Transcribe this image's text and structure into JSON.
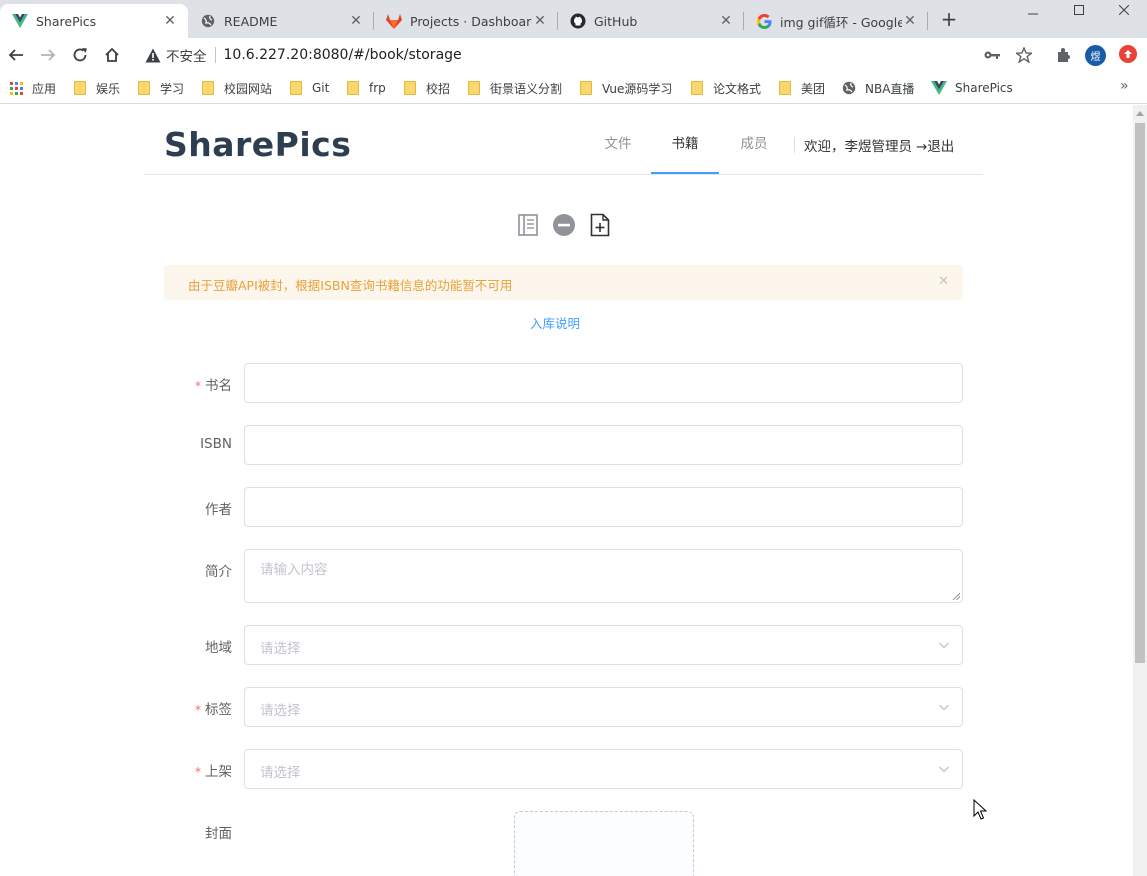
{
  "browser": {
    "tabs": [
      {
        "title": "SharePics",
        "favicon": "vue-icon",
        "active": true
      },
      {
        "title": "README",
        "favicon": "globe-icon",
        "active": false
      },
      {
        "title": "Projects · Dashboard",
        "favicon": "gitlab-icon",
        "active": false
      },
      {
        "title": "GitHub",
        "favicon": "github-icon",
        "active": false
      },
      {
        "title": "img gif循环 - Google",
        "favicon": "google-icon",
        "active": false
      }
    ],
    "security_label": "不安全",
    "url": "10.6.227.20:8080/#/book/storage",
    "profile_initial": "煜",
    "bookmarks": [
      {
        "label": "应用",
        "icon": "apps-grid-icon"
      },
      {
        "label": "娱乐",
        "icon": "folder-icon"
      },
      {
        "label": "学习",
        "icon": "folder-icon"
      },
      {
        "label": "校园网站",
        "icon": "folder-icon"
      },
      {
        "label": "Git",
        "icon": "folder-icon"
      },
      {
        "label": "frp",
        "icon": "folder-icon"
      },
      {
        "label": "校招",
        "icon": "folder-icon"
      },
      {
        "label": "街景语义分割",
        "icon": "folder-icon"
      },
      {
        "label": "Vue源码学习",
        "icon": "folder-icon"
      },
      {
        "label": "论文格式",
        "icon": "folder-icon"
      },
      {
        "label": "美团",
        "icon": "folder-icon"
      },
      {
        "label": "NBA直播",
        "icon": "globe-icon"
      },
      {
        "label": "SharePics",
        "icon": "vue-icon"
      }
    ]
  },
  "header": {
    "logo": "SharePics",
    "nav": [
      {
        "label": "文件",
        "active": false
      },
      {
        "label": "书籍",
        "active": true
      },
      {
        "label": "成员",
        "active": false
      }
    ],
    "welcome": "欢迎，李煜管理员",
    "logout": "退出"
  },
  "alert": {
    "message": "由于豆瓣API被封，根据ISBN查询书籍信息的功能暂不可用"
  },
  "help_link": "入库说明",
  "form": {
    "fields": [
      {
        "label": "书名",
        "required": true,
        "type": "input",
        "placeholder": ""
      },
      {
        "label": "ISBN",
        "required": false,
        "type": "input",
        "placeholder": ""
      },
      {
        "label": "作者",
        "required": false,
        "type": "input",
        "placeholder": ""
      },
      {
        "label": "简介",
        "required": false,
        "type": "textarea",
        "placeholder": "请输入内容"
      },
      {
        "label": "地域",
        "required": false,
        "type": "select",
        "placeholder": "请选择"
      },
      {
        "label": "标签",
        "required": true,
        "type": "select",
        "placeholder": "请选择"
      },
      {
        "label": "上架",
        "required": true,
        "type": "select",
        "placeholder": "请选择"
      },
      {
        "label": "封面",
        "required": false,
        "type": "upload",
        "placeholder": ""
      }
    ]
  },
  "colors": {
    "primary": "#409eff",
    "warning": "#e6a23c",
    "warning_bg": "#fdf6ec",
    "danger": "#f56c6c",
    "logo": "#2c3e50"
  }
}
